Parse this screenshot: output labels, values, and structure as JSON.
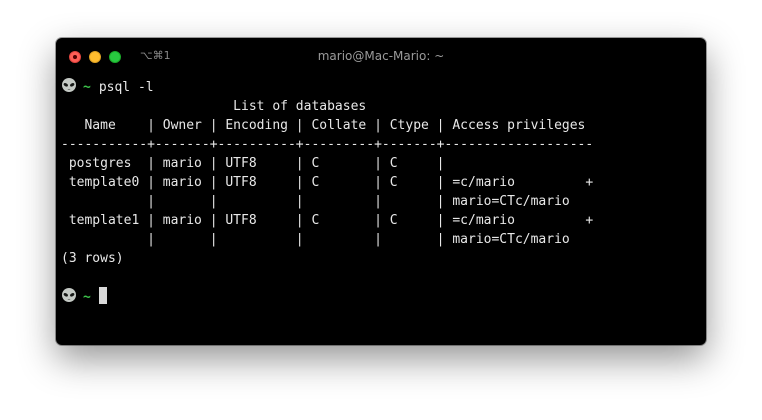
{
  "window": {
    "title": "mario@Mac-Mario: ~",
    "shortcut": "⌥⌘1"
  },
  "prompt": {
    "icon": "alien-icon",
    "cwd": "~",
    "cwd_color": "#3cc24a"
  },
  "command": "psql -l",
  "output": [
    "                      List of databases",
    "   Name    | Owner | Encoding | Collate | Ctype | Access privileges",
    "-----------+-------+----------+---------+-------+-------------------",
    " postgres  | mario | UTF8     | C       | C     |",
    " template0 | mario | UTF8     | C       | C     | =c/mario         +",
    "           |       |          |         |       | mario=CTc/mario",
    " template1 | mario | UTF8     | C       | C     | =c/mario         +",
    "           |       |          |         |       | mario=CTc/mario",
    "(3 rows)"
  ],
  "colors": {
    "background": "#000000",
    "text": "#e8e8e8",
    "close": "#ff5f57",
    "minimize": "#febc2e",
    "maximize": "#28c840"
  }
}
